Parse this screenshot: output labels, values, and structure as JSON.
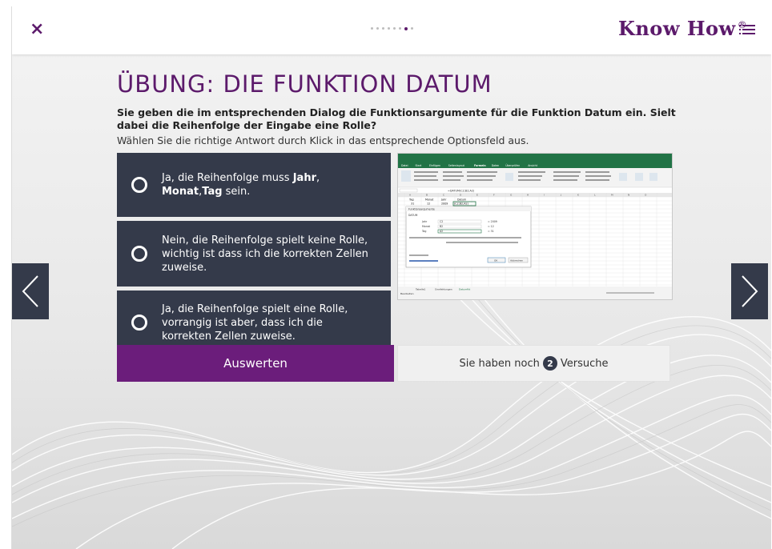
{
  "header": {
    "close_label": "×",
    "logo_text": "Know How",
    "logo_mark": "®",
    "progress": {
      "total": 8,
      "current": 7
    }
  },
  "exercise": {
    "title": "ÜBUNG: DIE FUNKTION DATUM",
    "question": "Sie geben die im entsprechenden Dialog die Funktionsargumente für die Funktion Datum ein. Sielt dabei die Reihenfolge der Eingabe eine Rolle?",
    "instruction": "Wählen Sie die richtige Antwort durch Klick in das entsprechende Optionsfeld aus.",
    "options": [
      {
        "pre": "Ja, die Reihenfolge muss ",
        "b1": "Jahr",
        "sep1": ", ",
        "b2": "Monat",
        "sep2": ",",
        "b3": "Tag",
        "post": " sein."
      },
      {
        "text": "Nein, die Reihenfolge spielt keine Rolle, wichtig ist dass ich die korrekten Zellen zuweise."
      },
      {
        "text": "Ja, die Reihenfolge spielt eine Rolle, vorrangig ist aber, dass ich die korrekten Zellen zuweise."
      }
    ],
    "evaluate_label": "Auswerten",
    "attempts": {
      "prefix": "Sie haben noch",
      "count": "2",
      "suffix": "Versuche"
    }
  },
  "screenshot": {
    "ribbon_tabs": [
      "Datei",
      "Start",
      "Einfügen",
      "Seitenlayout",
      "Formeln",
      "Daten",
      "Überprüfen",
      "Ansicht"
    ],
    "active_tab": "Formeln",
    "formula": "=DATUM(C2;B2;A2)",
    "columns": [
      "A",
      "B",
      "C",
      "D",
      "E",
      "F",
      "G",
      "H",
      "I",
      "J",
      "K",
      "L",
      "M",
      "N",
      "O"
    ],
    "row1": [
      "Tag",
      "Monat",
      "Jahr",
      "Datum"
    ],
    "row2": [
      "31",
      "12",
      "2009",
      "(C2;B2;A2)"
    ],
    "dialog_title": "Funktionsargumente",
    "dialog_function": "DATUM",
    "dialog_fields": [
      {
        "name": "Jahr",
        "ref": "C2",
        "val": "= 2009"
      },
      {
        "name": "Monat",
        "ref": "B2",
        "val": "= 12"
      },
      {
        "name": "Tag",
        "ref": "A2",
        "val": "= 31"
      }
    ],
    "ok_label": "OK",
    "cancel_label": "Abbrechen",
    "sheet_tabs": [
      "Tabelle1",
      "Sinnfehlungen",
      "Datumfkt"
    ],
    "status": "Bearbeiten"
  },
  "colors": {
    "brand": "#5c1a6b",
    "button": "#6b1d7b",
    "option_bg": "#343a4a",
    "excel_green": "#217346"
  },
  "icons": {
    "close": "close-icon",
    "menu": "list-menu-icon",
    "prev": "chevron-left-icon",
    "next": "chevron-right-icon",
    "radio": "radio-unchecked-icon"
  }
}
